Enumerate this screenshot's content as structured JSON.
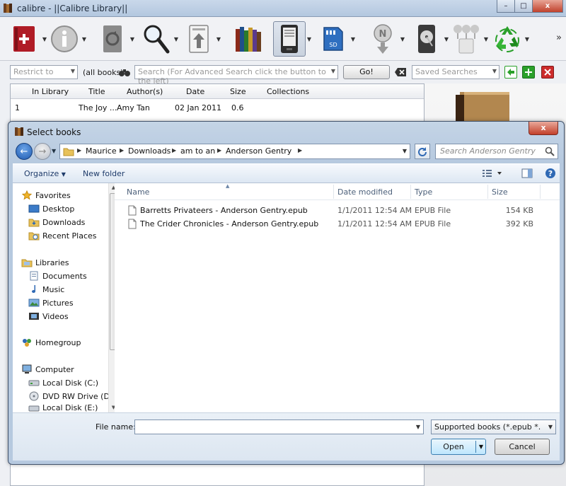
{
  "window": {
    "title": "calibre - ||Calibre Library||",
    "controls": {
      "minimize": "–",
      "maximize": "□",
      "close": "x"
    }
  },
  "toolbar": {
    "more": "»",
    "items": [
      {
        "icon": "add-books-icon"
      },
      {
        "icon": "edit-metadata-icon"
      },
      {
        "icon": "convert-books-icon"
      },
      {
        "icon": "view-icon"
      },
      {
        "icon": "send-to-device-icon"
      },
      {
        "icon": "library-icon"
      },
      {
        "icon": "device-icon"
      },
      {
        "icon": "sd-card-icon"
      },
      {
        "icon": "news-icon"
      },
      {
        "icon": "hdd-icon"
      },
      {
        "icon": "connect-share-icon"
      },
      {
        "icon": "remove-books-icon"
      }
    ]
  },
  "searchbar": {
    "restrict_placeholder": "Restrict to",
    "all_books": "(all books)",
    "search_placeholder": "Search (For Advanced Search click the button to the left)",
    "go_label": "Go!",
    "saved_searches_placeholder": "Saved Searches"
  },
  "booklist": {
    "columns": [
      "In Library",
      "Title",
      "Author(s)",
      "Date",
      "Size",
      "Collections"
    ],
    "rows": [
      {
        "num": "1",
        "title": "The Joy ...",
        "author": "Amy Tan",
        "date": "02 Jan 2011",
        "size": "0.6"
      }
    ]
  },
  "dialog": {
    "title": "Select books",
    "close": "x",
    "nav": {
      "back": "←",
      "forward": "→"
    },
    "breadcrumb": [
      "Maurice",
      "Downloads",
      "am to an",
      "Anderson Gentry"
    ],
    "search_placeholder": "Search Anderson Gentry",
    "commands": {
      "organize": "Organize",
      "new_folder": "New folder",
      "help": "?"
    },
    "nav_pane": {
      "favorites": {
        "label": "Favorites",
        "items": [
          "Desktop",
          "Downloads",
          "Recent Places"
        ]
      },
      "libraries": {
        "label": "Libraries",
        "items": [
          "Documents",
          "Music",
          "Pictures",
          "Videos"
        ]
      },
      "homegroup": "Homegroup",
      "computer": {
        "label": "Computer",
        "items": [
          "Local Disk (C:)",
          "DVD RW Drive (D",
          "Local Disk (E:)"
        ]
      }
    },
    "columns": [
      "Name",
      "Date modified",
      "Type",
      "Size"
    ],
    "files": [
      {
        "name": "Barretts Privateers - Anderson Gentry.epub",
        "date": "1/1/2011 12:54 AM",
        "type": "EPUB File",
        "size": "154 KB"
      },
      {
        "name": "The Crider Chronicles - Anderson Gentry.epub",
        "date": "1/1/2011 12:54 AM",
        "type": "EPUB File",
        "size": "392 KB"
      }
    ],
    "file_name_label": "File name:",
    "file_name_value": "",
    "file_type": "Supported books (*.epub *.pdb",
    "open_label": "Open",
    "cancel_label": "Cancel"
  },
  "colors": {
    "accent": "#1f5ab0",
    "close_red": "#c3402a",
    "add_green": "#2aa02a",
    "clear_red": "#cc2b2b"
  }
}
